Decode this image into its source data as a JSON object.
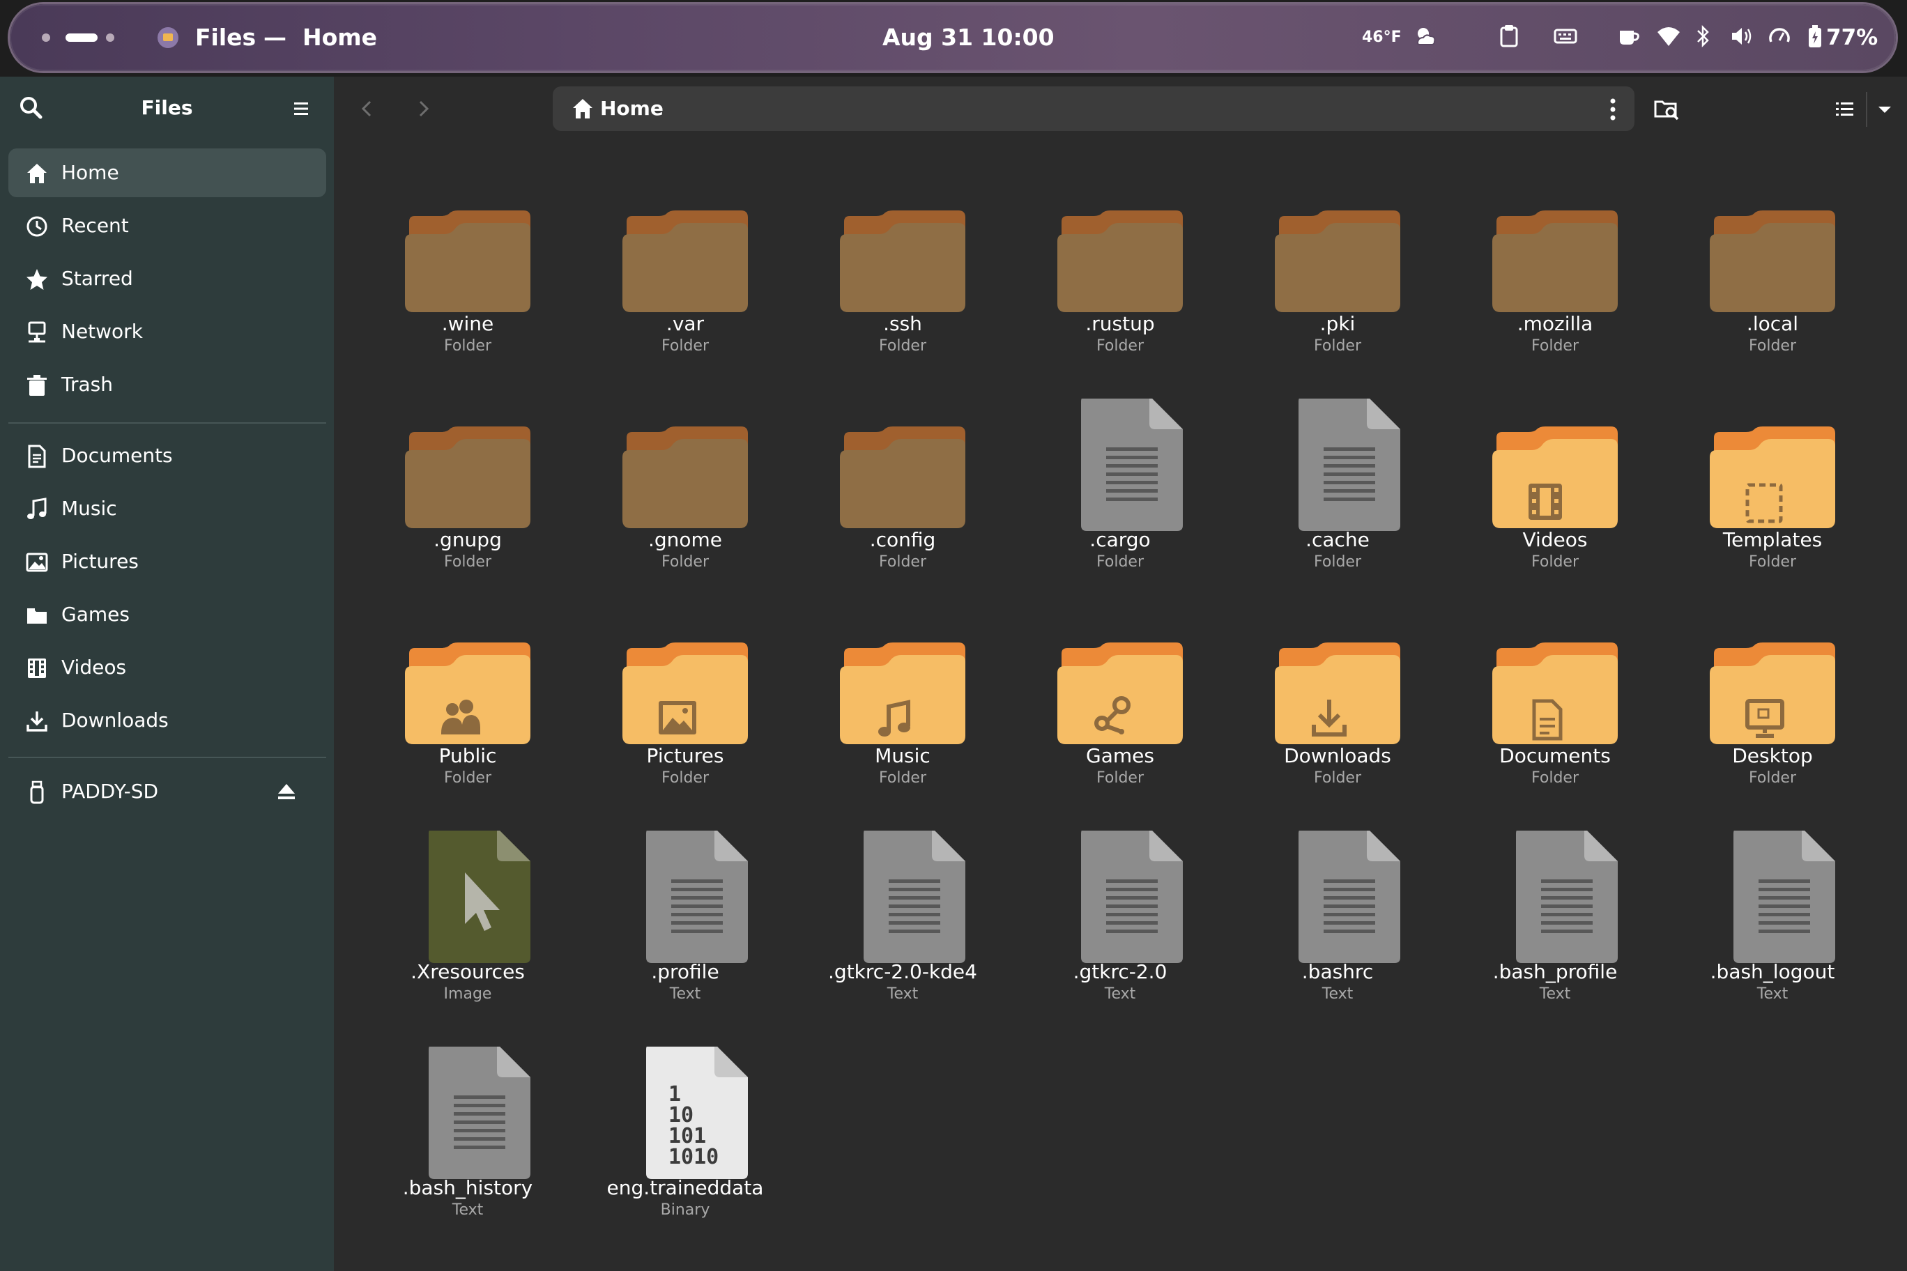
{
  "topbar": {
    "app_name": "Files",
    "separator": "—",
    "window_title": "Home",
    "datetime": "Aug 31  10:00",
    "weather_temp": "46°F",
    "battery": "77%"
  },
  "sidebar": {
    "title": "Files",
    "places": [
      {
        "label": "Home",
        "icon": "home-icon",
        "active": true
      },
      {
        "label": "Recent",
        "icon": "clock-icon"
      },
      {
        "label": "Starred",
        "icon": "star-icon"
      },
      {
        "label": "Network",
        "icon": "network-icon"
      },
      {
        "label": "Trash",
        "icon": "trash-icon"
      }
    ],
    "bookmarks": [
      {
        "label": "Documents",
        "icon": "document-icon"
      },
      {
        "label": "Music",
        "icon": "music-icon"
      },
      {
        "label": "Pictures",
        "icon": "picture-icon"
      },
      {
        "label": "Games",
        "icon": "folder-icon"
      },
      {
        "label": "Videos",
        "icon": "film-icon"
      },
      {
        "label": "Downloads",
        "icon": "download-icon"
      }
    ],
    "devices": [
      {
        "label": "PADDY-SD",
        "icon": "usb-drive-icon"
      }
    ]
  },
  "pathbar": {
    "location": "Home"
  },
  "files": [
    {
      "name": ".wine",
      "type": "Folder",
      "icon": "hidden-folder"
    },
    {
      "name": ".var",
      "type": "Folder",
      "icon": "hidden-folder"
    },
    {
      "name": ".ssh",
      "type": "Folder",
      "icon": "hidden-folder"
    },
    {
      "name": ".rustup",
      "type": "Folder",
      "icon": "hidden-folder"
    },
    {
      "name": ".pki",
      "type": "Folder",
      "icon": "hidden-folder"
    },
    {
      "name": ".mozilla",
      "type": "Folder",
      "icon": "hidden-folder"
    },
    {
      "name": ".local",
      "type": "Folder",
      "icon": "hidden-folder"
    },
    {
      "name": ".gnupg",
      "type": "Folder",
      "icon": "hidden-folder"
    },
    {
      "name": ".gnome",
      "type": "Folder",
      "icon": "hidden-folder"
    },
    {
      "name": ".config",
      "type": "Folder",
      "icon": "hidden-folder"
    },
    {
      "name": ".cargo",
      "type": "Folder",
      "icon": "text-file"
    },
    {
      "name": ".cache",
      "type": "Folder",
      "icon": "text-file"
    },
    {
      "name": "Videos",
      "type": "Folder",
      "icon": "videos-folder"
    },
    {
      "name": "Templates",
      "type": "Folder",
      "icon": "templates-folder"
    },
    {
      "name": "Public",
      "type": "Folder",
      "icon": "public-folder"
    },
    {
      "name": "Pictures",
      "type": "Folder",
      "icon": "pictures-folder"
    },
    {
      "name": "Music",
      "type": "Folder",
      "icon": "music-folder"
    },
    {
      "name": "Games",
      "type": "Folder",
      "icon": "games-folder"
    },
    {
      "name": "Downloads",
      "type": "Folder",
      "icon": "downloads-folder"
    },
    {
      "name": "Documents",
      "type": "Folder",
      "icon": "documents-folder"
    },
    {
      "name": "Desktop",
      "type": "Folder",
      "icon": "desktop-folder"
    },
    {
      "name": ".Xresources",
      "type": "Image",
      "icon": "cursor-file"
    },
    {
      "name": ".profile",
      "type": "Text",
      "icon": "text-file"
    },
    {
      "name": ".gtkrc-2.0-kde4",
      "type": "Text",
      "icon": "text-file"
    },
    {
      "name": ".gtkrc-2.0",
      "type": "Text",
      "icon": "text-file"
    },
    {
      "name": ".bashrc",
      "type": "Text",
      "icon": "text-file"
    },
    {
      "name": ".bash_profile",
      "type": "Text",
      "icon": "text-file"
    },
    {
      "name": ".bash_logout",
      "type": "Text",
      "icon": "text-file"
    },
    {
      "name": ".bash_history",
      "type": "Text",
      "icon": "text-file"
    },
    {
      "name": "eng.traineddata",
      "type": "Binary",
      "icon": "binary-file"
    }
  ],
  "colors": {
    "hidden_folder_body": "#8f6e45",
    "hidden_folder_tab": "#a0602e",
    "folder_body": "#f6bd65",
    "folder_tab": "#ec8a38",
    "folder_glyph": "#8d6a3e",
    "text_file": "#8c8c8c",
    "sidebar_bg": "#2e3c3c",
    "main_bg": "#2b2b2b"
  }
}
